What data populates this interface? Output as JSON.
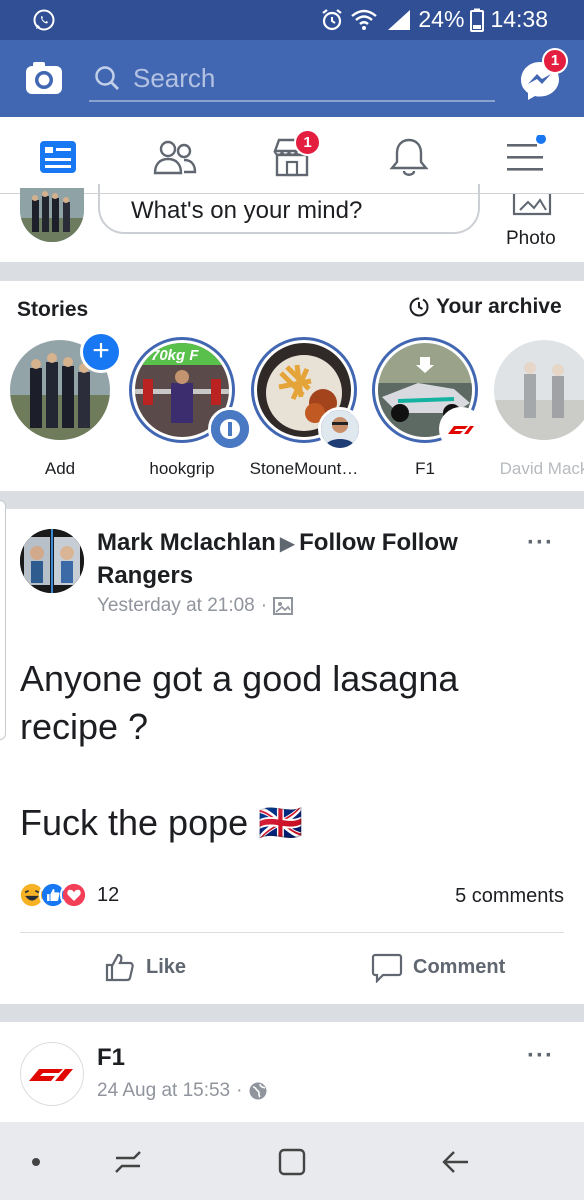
{
  "status_bar": {
    "battery": "24%",
    "time": "14:38"
  },
  "header": {
    "search_placeholder": "Search",
    "messenger_badge": "1"
  },
  "nav": {
    "marketplace_badge": "1"
  },
  "composer": {
    "placeholder": "What's on your mind?",
    "photo_label": "Photo"
  },
  "stories": {
    "title": "Stories",
    "archive_label": "Your archive",
    "items": [
      {
        "label": "Add"
      },
      {
        "label": "hookgrip",
        "overlay_text": "70kg F"
      },
      {
        "label": "StoneMount…"
      },
      {
        "label": "F1"
      },
      {
        "label": "David Mack"
      }
    ]
  },
  "post1": {
    "author": "Mark Mclachlan",
    "target": "Follow Follow Rangers",
    "time": "Yesterday at 21:08",
    "lines": [
      "Anyone got a good lasagna",
      "recipe ?",
      "",
      "Fuck the pope 🇬🇧"
    ],
    "reaction_count": "12",
    "comments": "5 comments",
    "like_label": "Like",
    "comment_label": "Comment"
  },
  "post2": {
    "author": "F1",
    "time": "24 Aug at 15:53"
  },
  "colors": {
    "brand": "#4267b2",
    "status": "#304f94",
    "badge": "#e41e3f"
  }
}
